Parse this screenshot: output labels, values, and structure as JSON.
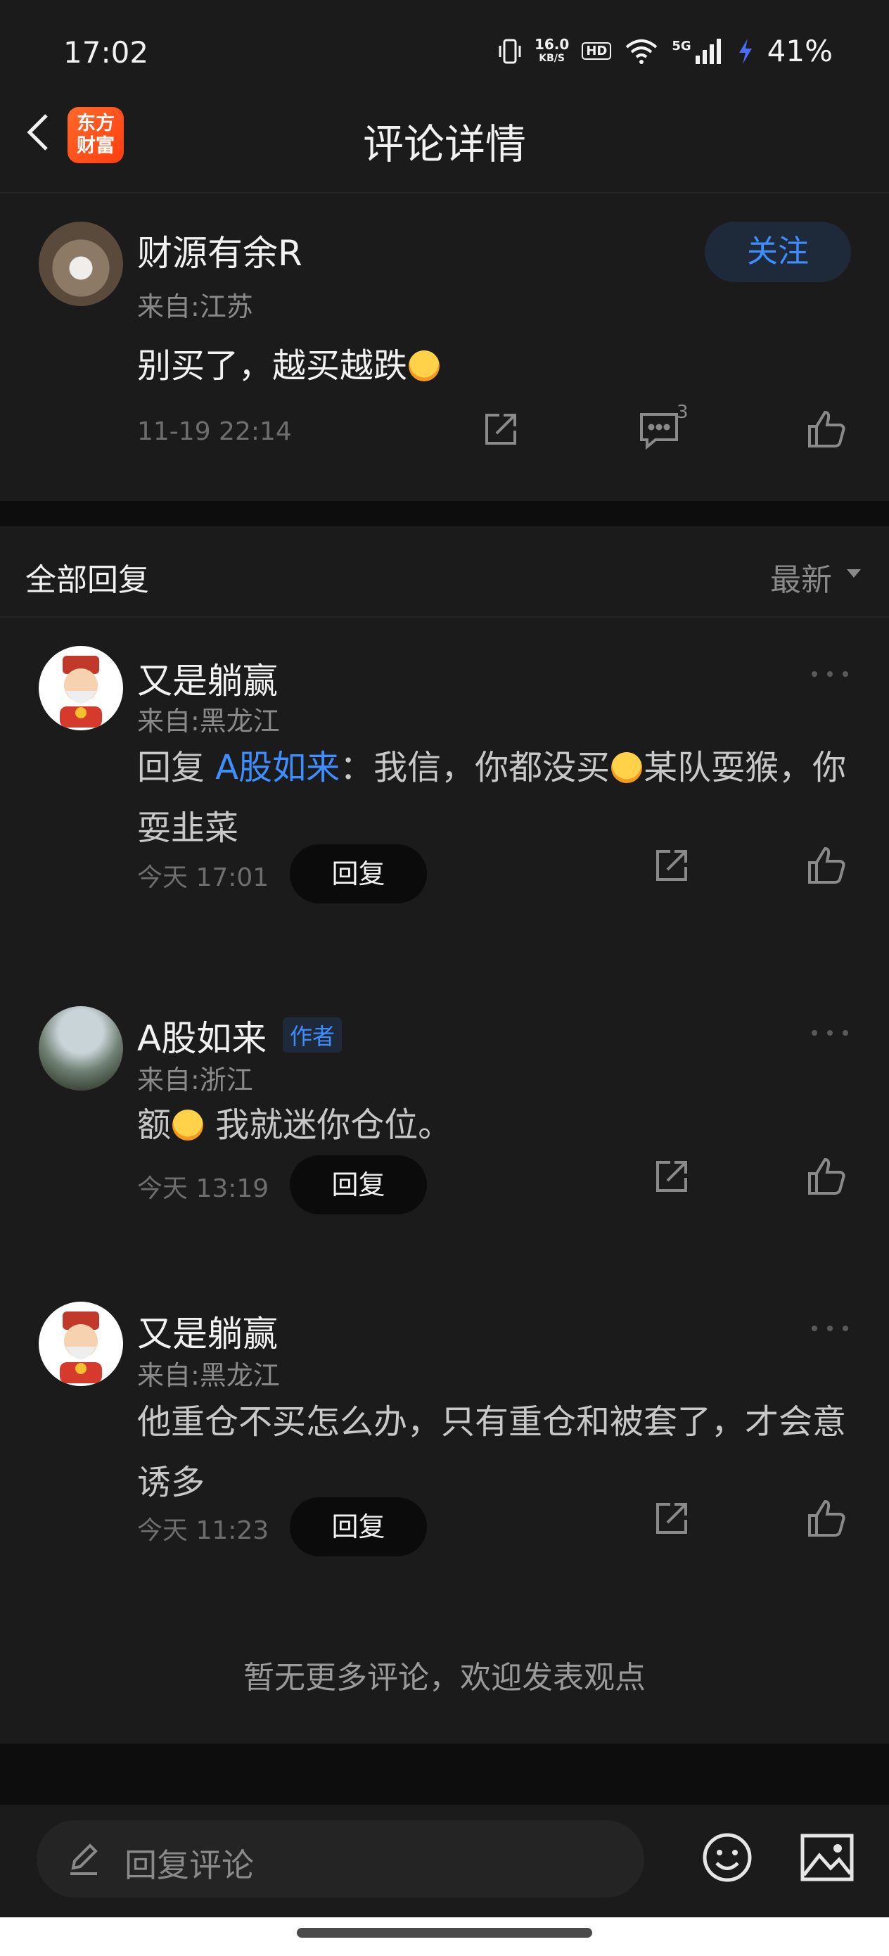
{
  "status": {
    "time": "17:02",
    "net_speed_value": "16.0",
    "net_speed_unit": "KB/S",
    "hd_label": "HD",
    "signal_label": "5G",
    "battery": "41%"
  },
  "nav": {
    "logo_line1": "东方",
    "logo_line2": "财富",
    "title": "评论详情"
  },
  "post": {
    "user_name": "财源有余R",
    "location": "来自:江苏",
    "text": "别买了，越买越跌",
    "follow_label": "关注",
    "timestamp": "11-19 22:14",
    "comment_count": "3"
  },
  "replies_section": {
    "title": "全部回复",
    "sort_label": "最新"
  },
  "replies": [
    {
      "user_name": "又是躺赢",
      "location": "来自:黑龙江",
      "reply_prefix": "回复 ",
      "mention": "A股如来",
      "text_part1": "：我信，你都没买",
      "text_part2": "某队耍猴，你耍韭菜",
      "time": "今天 17:01",
      "reply_button": "回复"
    },
    {
      "user_name": "A股如来",
      "author_badge": "作者",
      "location": "来自:浙江",
      "text_part1": "额",
      "text_part2": " 我就迷你仓位。",
      "time": "今天 13:19",
      "reply_button": "回复"
    },
    {
      "user_name": "又是躺赢",
      "location": "来自:黑龙江",
      "text": "他重仓不买怎么办，只有重仓和被套了，才会意诱多",
      "time": "今天 11:23",
      "reply_button": "回复"
    }
  ],
  "footer_note": "暂无更多评论，欢迎发表观点",
  "bottom_bar": {
    "input_placeholder": "回复评论"
  },
  "icons": {
    "back": "chevron-left-icon",
    "share": "share-icon",
    "comment": "comment-icon",
    "like": "thumbs-up-icon",
    "more": "more-dots-icon",
    "pencil": "pencil-icon",
    "emoji": "emoji-icon",
    "image": "image-icon",
    "sort_caret": "caret-down-icon"
  },
  "colors": {
    "accent": "#3d8eff",
    "background": "#1b1b1b",
    "logo": "#ff4d1a"
  }
}
